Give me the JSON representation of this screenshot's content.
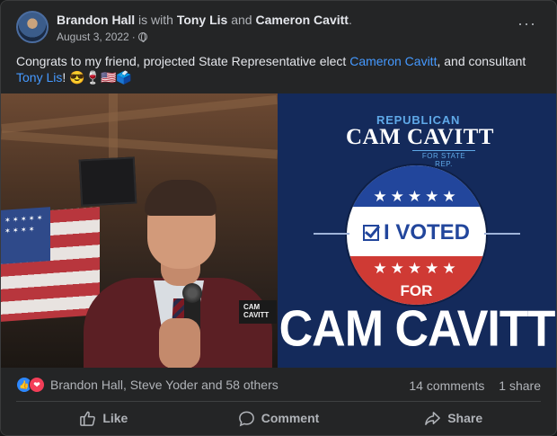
{
  "post": {
    "author": "Brandon Hall",
    "with_text": "is with",
    "tagged_1": "Tony Lis",
    "and_text": "and",
    "tagged_2": "Cameron Cavitt",
    "period": ".",
    "date": "August 3, 2022",
    "date_sep": "·",
    "text_before": "Congrats to my friend, projected State Representative elect ",
    "link_1": "Cameron Cavitt",
    "text_middle": ", and consultant ",
    "link_2": "Tony Lis",
    "text_after": "! 😎🍷🇺🇸🗳️",
    "more_label": "···"
  },
  "media": {
    "badge_line1": "CAM",
    "badge_line2": "CAVITT",
    "ad_line1": "REPUBLICAN",
    "ad_line2": "CAM CAVITT",
    "ad_line3": "FOR STATE REP.",
    "stars": "★★★★★",
    "voted": "I VOTED",
    "for": "FOR",
    "big": "CAM CAVITT"
  },
  "footer": {
    "reaction_names": "Brandon Hall, Steve Yoder and 58 others",
    "comments": "14 comments",
    "shares": "1 share",
    "like_label": "Like",
    "comment_label": "Comment",
    "share_label": "Share"
  },
  "colors": {
    "link": "#4599ff",
    "ad_navy": "#142a5b",
    "ad_red": "#cf3a34",
    "like_blue": "#2d88ff",
    "love_red": "#f33e58"
  }
}
